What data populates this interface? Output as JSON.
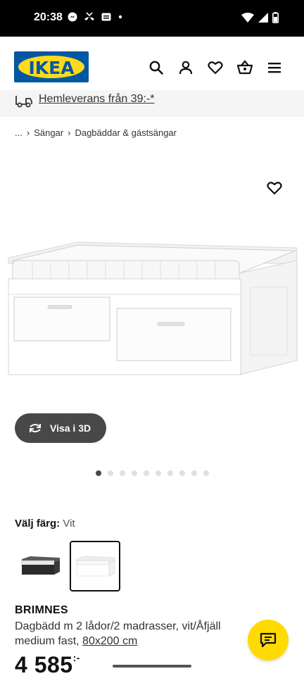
{
  "status_bar": {
    "time": "20:38",
    "left_icons": [
      "messenger-icon",
      "missed-call-icon",
      "message-icon",
      "dot-icon"
    ],
    "right_icons": [
      "wifi-icon",
      "signal-icon",
      "battery-icon"
    ]
  },
  "header": {
    "logo_text": "IKEA",
    "icons": [
      "search-icon",
      "account-icon",
      "heart-icon",
      "basket-icon",
      "menu-icon"
    ]
  },
  "delivery": {
    "text": "Hemleverans från 39:-*"
  },
  "breadcrumb": {
    "items": [
      "...",
      "Sängar",
      "Dagbäddar & gästsängar"
    ]
  },
  "product": {
    "view_3d_label": "Visa i 3D",
    "carousel": {
      "total": 10,
      "active_index": 0
    },
    "color_label": "Välj färg:",
    "color_value": "Vit",
    "swatches": [
      "Svart",
      "Vit"
    ],
    "selected_swatch": 1,
    "name": "BRIMNES",
    "description": "Dagbädd m 2 lådor/2 madrasser, vit/Åfjäll medium fast,",
    "size": "80x200 cm",
    "price": "4 585",
    "price_suffix": ":-"
  },
  "colors": {
    "brand_blue": "#0058a3",
    "brand_yellow": "#ffda1a",
    "chat_yellow": "#ffdb00",
    "pill_dark": "#484848"
  }
}
